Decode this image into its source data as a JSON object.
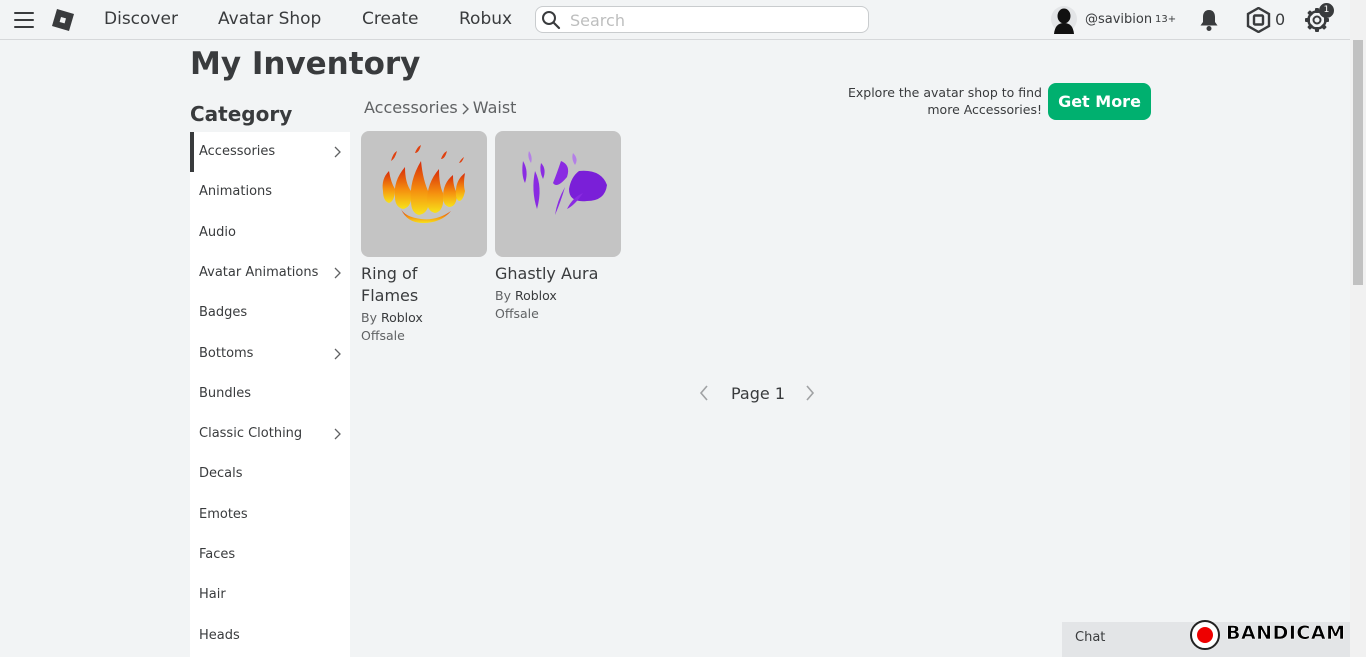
{
  "nav": {
    "links": [
      "Discover",
      "Avatar Shop",
      "Create",
      "Robux"
    ],
    "search_placeholder": "Search",
    "username": "@savibion",
    "age_badge": "13+",
    "robux_count": "0",
    "settings_badge": "1"
  },
  "page": {
    "title": "My Inventory",
    "category_heading": "Category"
  },
  "categories": [
    {
      "label": "Accessories",
      "has_submenu": true,
      "active": true
    },
    {
      "label": "Animations",
      "has_submenu": false
    },
    {
      "label": "Audio",
      "has_submenu": false
    },
    {
      "label": "Avatar Animations",
      "has_submenu": true
    },
    {
      "label": "Badges",
      "has_submenu": false
    },
    {
      "label": "Bottoms",
      "has_submenu": true
    },
    {
      "label": "Bundles",
      "has_submenu": false
    },
    {
      "label": "Classic Clothing",
      "has_submenu": true
    },
    {
      "label": "Decals",
      "has_submenu": false
    },
    {
      "label": "Emotes",
      "has_submenu": false
    },
    {
      "label": "Faces",
      "has_submenu": false
    },
    {
      "label": "Hair",
      "has_submenu": false
    },
    {
      "label": "Heads",
      "has_submenu": false
    }
  ],
  "breadcrumb": {
    "parent": "Accessories",
    "current": "Waist"
  },
  "promo": {
    "line1": "Explore the avatar shop to find",
    "line2": "more Accessories!",
    "button_label": "Get More"
  },
  "items": [
    {
      "name_line1": "Ring of",
      "name_line2": "Flames",
      "by_label": "By",
      "creator": "Roblox",
      "status": "Offsale"
    },
    {
      "name_line1": "Ghastly Aura",
      "name_line2": "",
      "by_label": "By",
      "creator": "Roblox",
      "status": "Offsale"
    }
  ],
  "pager": {
    "label": "Page 1"
  },
  "chat": {
    "label": "Chat"
  },
  "watermark": {
    "text": "BANDICAM"
  },
  "colors": {
    "accent_green": "#00b06f",
    "text_primary": "#393b3d",
    "background": "#f2f4f5"
  }
}
